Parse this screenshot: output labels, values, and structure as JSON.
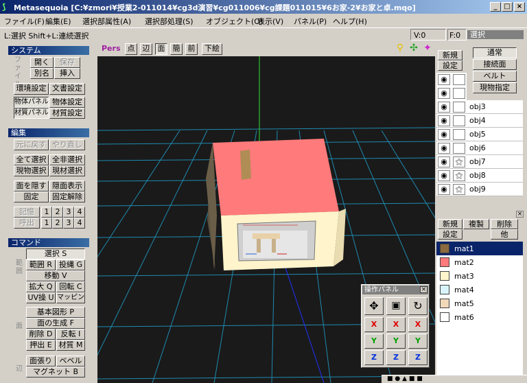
{
  "window": {
    "app_name": "Metasequoia",
    "path": "[C:¥zmori¥授業2-011014¥cg3d演習¥cg011006¥cg課題011015¥6お家-2¥お家と卓.mqo]"
  },
  "menu": [
    "ファイル(F)",
    "編集(E)",
    "選択部属性(A)",
    "選択部処理(S)",
    "オブジェクト(O)",
    "表示(V)",
    "パネル(P)",
    "ヘルプ(H)"
  ],
  "hint": "L:選択  Shift+L:連続選択",
  "counts": {
    "v": "V:0",
    "f": "F:0"
  },
  "system": {
    "title": "システム",
    "tab": "ファイル",
    "open": "開く",
    "save": "保存",
    "rename": "別名",
    "insert": "挿入",
    "env": "環境設定",
    "doc": "文書設定",
    "obj_panel": "物体パネル",
    "obj_set": "物体設定",
    "mat_panel": "材質パネル",
    "mat_set": "材質設定"
  },
  "edit": {
    "title": "編集",
    "undo": "元に戻す",
    "redo": "やり直し",
    "sel_all": "全て選択",
    "desel_all": "全非選択",
    "cur_obj_sel": "現物選択",
    "cur_mat_sel": "現材選択",
    "hide": "面を隠す",
    "show": "隠面表示",
    "fix": "固定",
    "unfix": "固定解除",
    "memory": "記憶",
    "recall": "呼出",
    "n1": "1",
    "n2": "2",
    "n3": "3",
    "n4": "4"
  },
  "command": {
    "title": "コマンド",
    "tab_range": "範囲",
    "tab_face": "面",
    "tab_edge": "辺",
    "select": "選択 S",
    "range": "範囲 R",
    "lasso": "投縄 G",
    "move": "移動 V",
    "scale": "拡大 Q",
    "rotate": "回転 C",
    "uv": "UV操 U",
    "mapping": "マッピング",
    "primitive": "基本図形 P",
    "face_gen": "面の生成 F",
    "delete": "削除 D",
    "flip": "反転 I",
    "extrude": "押出 E",
    "material": "材質 M",
    "face_stretch": "面張り",
    "bevel": "ベベル",
    "magnet": "マグネット B"
  },
  "viewport": {
    "pers": "Pers",
    "vertex": "点",
    "edge": "辺",
    "face": "面",
    "simple": "簡",
    "front": "前",
    "wire": "下絵"
  },
  "select_panel": {
    "title": "選択",
    "normal": "通常",
    "connected": "接続面",
    "belt": "ベルト",
    "cur_obj": "現物指定"
  },
  "object_panel": {
    "new": "新規",
    "settings": "設定",
    "objects": [
      "obj3",
      "obj4",
      "obj5",
      "obj6",
      "obj7",
      "obj8",
      "obj9"
    ]
  },
  "material_panel": {
    "new": "新規",
    "copy": "複製",
    "delete": "削除",
    "settings": "設定",
    "other": "他",
    "materials": [
      {
        "name": "mat1",
        "color": "#8b6a3e"
      },
      {
        "name": "mat2",
        "color": "#ff7a7a"
      },
      {
        "name": "mat3",
        "color": "#fff4cc"
      },
      {
        "name": "mat4",
        "color": "#d8f4ff"
      },
      {
        "name": "mat5",
        "color": "#f0d8b8"
      },
      {
        "name": "mat6",
        "color": "#ffffff"
      }
    ]
  },
  "op_panel": {
    "title": "操作パネル",
    "x": "X",
    "y": "Y",
    "z": "Z"
  }
}
